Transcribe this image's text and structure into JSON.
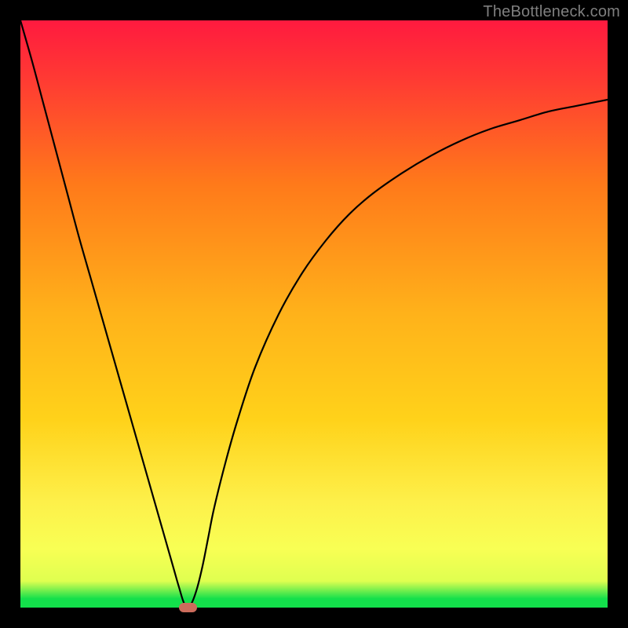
{
  "watermark": {
    "text": "TheBottleneck.com"
  },
  "colors": {
    "frame": "#000000",
    "watermark": "#7f7f7f",
    "curve": "#000000",
    "marker": "#cc6c5c",
    "gradient_top": "#ff1a3f",
    "gradient_mid1": "#ff7a1a",
    "gradient_mid2": "#ffd21a",
    "gradient_mid3": "#fff31a",
    "gradient_green": "#13e04b"
  },
  "chart_data": {
    "type": "line",
    "title": "",
    "xlabel": "",
    "ylabel": "",
    "xlim": [
      0,
      100
    ],
    "ylim": [
      0,
      100
    ],
    "series": [
      {
        "name": "bottleneck-curve",
        "x": [
          0,
          2,
          4,
          6,
          8,
          10,
          12,
          14,
          16,
          18,
          20,
          22,
          24,
          26,
          27,
          28,
          29,
          30,
          31,
          32,
          33,
          35,
          37,
          40,
          44,
          48,
          52,
          56,
          60,
          65,
          70,
          75,
          80,
          85,
          90,
          95,
          100
        ],
        "values": [
          100,
          93,
          85.5,
          78,
          70.5,
          63,
          56,
          49,
          42,
          35,
          28,
          21,
          14,
          7,
          3.5,
          0.5,
          0.5,
          3,
          7,
          12,
          17,
          25,
          32,
          41,
          50,
          57,
          62.5,
          67,
          70.5,
          74,
          77,
          79.5,
          81.5,
          83,
          84.5,
          85.5,
          86.5
        ]
      }
    ],
    "marker": {
      "x": 28.5,
      "y": 0,
      "width_pct": 3.1,
      "height_pct": 1.7
    },
    "background_gradient": {
      "orientation": "vertical",
      "stops": [
        {
          "pos": 0.0,
          "color": "#ff1a3f"
        },
        {
          "pos": 0.1,
          "color": "#ff3a33"
        },
        {
          "pos": 0.28,
          "color": "#ff7a1a"
        },
        {
          "pos": 0.5,
          "color": "#ffb21a"
        },
        {
          "pos": 0.68,
          "color": "#ffd21a"
        },
        {
          "pos": 0.82,
          "color": "#fdf04a"
        },
        {
          "pos": 0.9,
          "color": "#f8ff54"
        },
        {
          "pos": 0.955,
          "color": "#dfff50"
        },
        {
          "pos": 0.985,
          "color": "#13e04b"
        },
        {
          "pos": 1.0,
          "color": "#13e04b"
        }
      ]
    }
  }
}
